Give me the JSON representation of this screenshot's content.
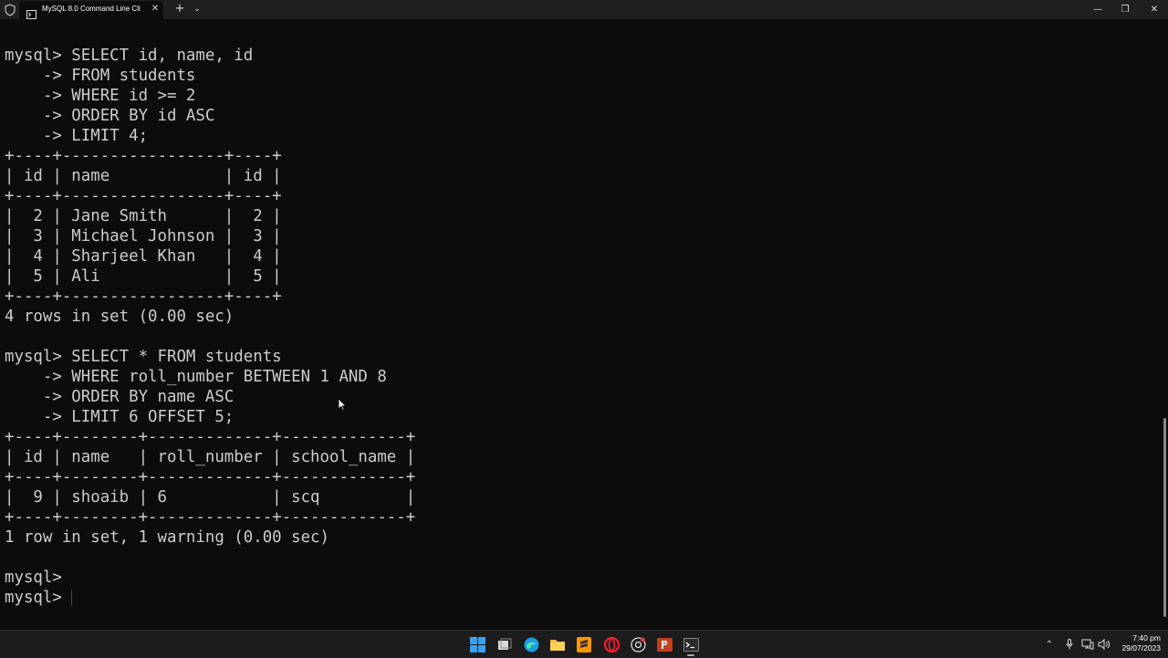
{
  "window": {
    "tab_title": "MySQL 8.0 Command Line Cli",
    "close_tab_glyph": "✕",
    "new_tab_glyph": "+",
    "dropdown_glyph": "⌄",
    "minimize_glyph": "—",
    "maximize_glyph": "❐",
    "close_glyph": "✕"
  },
  "console": {
    "lines": [
      "mysql> SELECT id, name, id",
      "    -> FROM students",
      "    -> WHERE id >= 2",
      "    -> ORDER BY id ASC",
      "    -> LIMIT 4;",
      "+----+-----------------+----+",
      "| id | name            | id |",
      "+----+-----------------+----+",
      "|  2 | Jane Smith      |  2 |",
      "|  3 | Michael Johnson |  3 |",
      "|  4 | Sharjeel Khan   |  4 |",
      "|  5 | Ali             |  5 |",
      "+----+-----------------+----+",
      "4 rows in set (0.00 sec)",
      "",
      "mysql> SELECT * FROM students",
      "    -> WHERE roll_number BETWEEN 1 AND 8",
      "    -> ORDER BY name ASC",
      "    -> LIMIT 6 OFFSET 5;",
      "+----+--------+-------------+-------------+",
      "| id | name   | roll_number | school_name |",
      "+----+--------+-------------+-------------+",
      "|  9 | shoaib | 6           | scq         |",
      "+----+--------+-------------+-------------+",
      "1 row in set, 1 warning (0.00 sec)",
      "",
      "mysql>",
      "mysql> "
    ]
  },
  "taskbar": {
    "apps": [
      {
        "name": "start-button",
        "icon": "windows-logo-icon"
      },
      {
        "name": "task-view-button",
        "icon": "task-view-icon"
      },
      {
        "name": "edge-button",
        "icon": "edge-icon"
      },
      {
        "name": "file-explorer-button",
        "icon": "folder-icon"
      },
      {
        "name": "sublime-text-button",
        "icon": "sublime-icon"
      },
      {
        "name": "opera-button",
        "icon": "opera-icon"
      },
      {
        "name": "chrome-button",
        "icon": "chrome-icon"
      },
      {
        "name": "powerpoint-button",
        "icon": "powerpoint-icon"
      },
      {
        "name": "terminal-button",
        "icon": "terminal-icon"
      }
    ],
    "tray": {
      "chevron_glyph": "⌃",
      "mic_glyph": "🎤",
      "speaker_glyph": "🔊"
    },
    "time": "7:40 pm",
    "date": "29/07/2023"
  },
  "colors": {
    "console_bg": "#0c0c0c",
    "console_text": "#cccccc",
    "taskbar_bg": "#1c1c1c"
  }
}
